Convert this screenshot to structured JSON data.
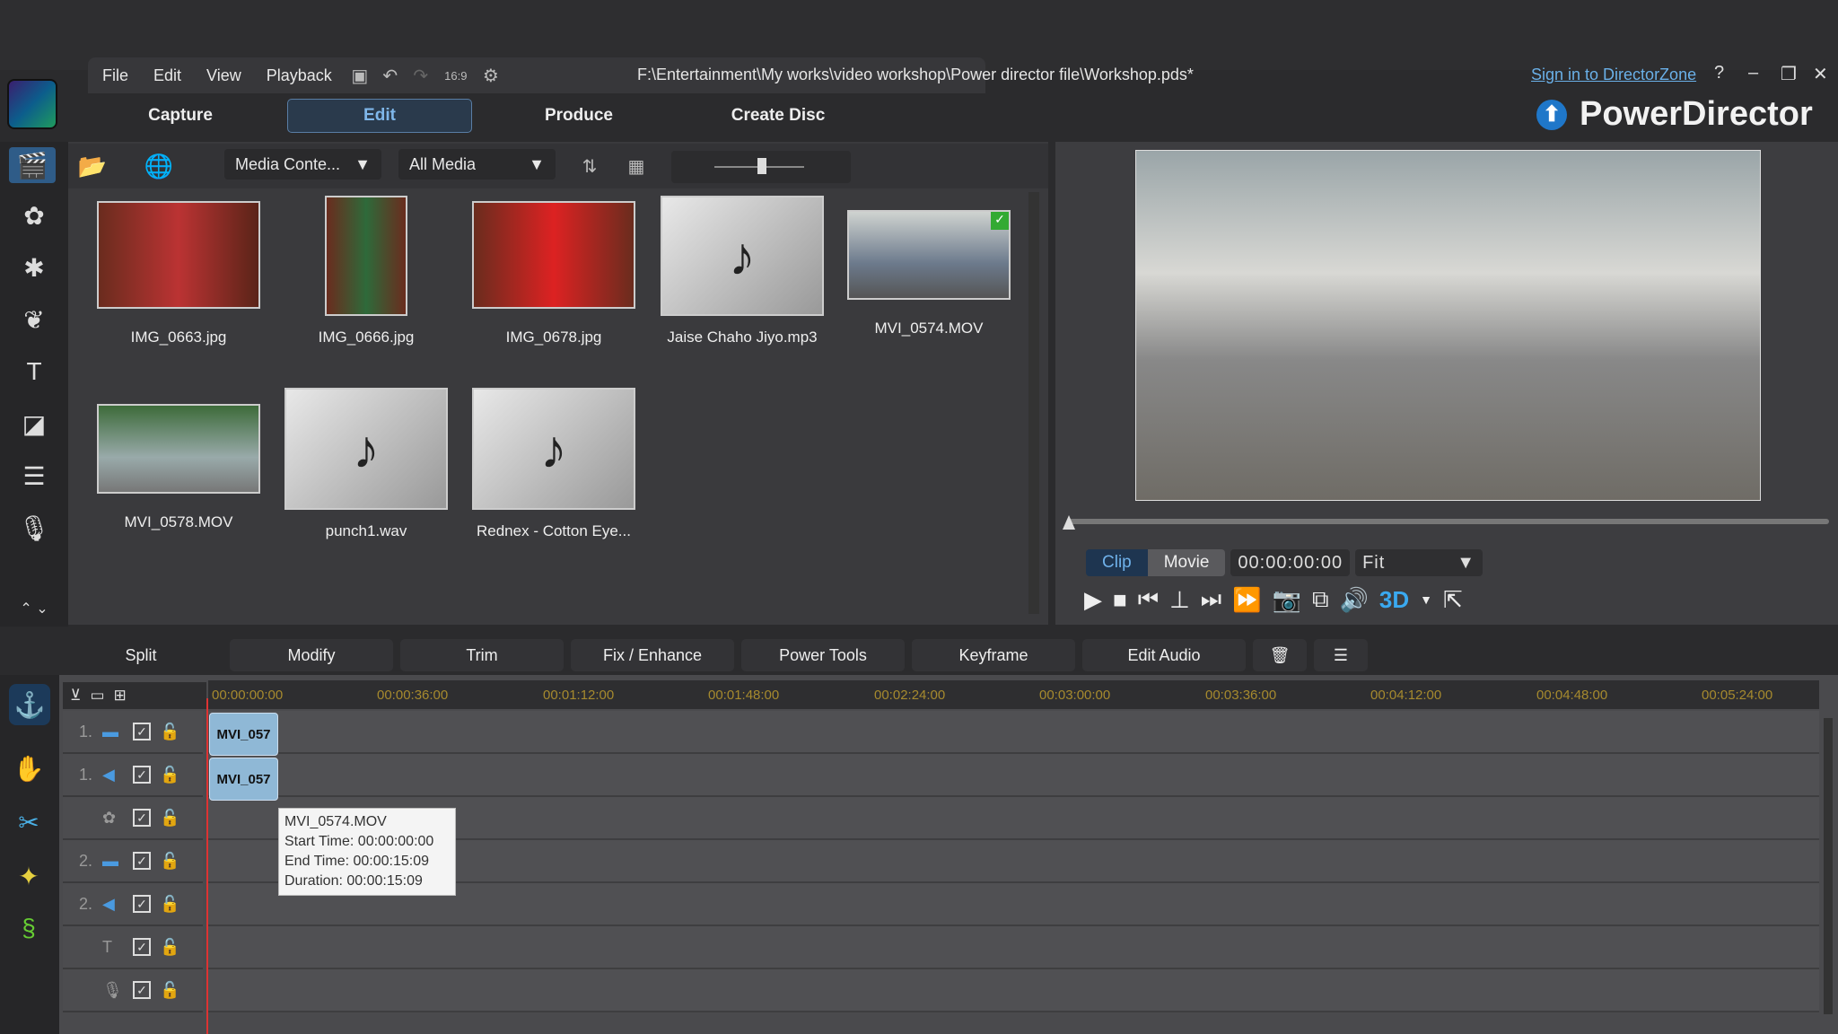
{
  "menu": [
    "File",
    "Edit",
    "View",
    "Playback"
  ],
  "aspect": "16:9",
  "file_path": "F:\\Entertainment\\My works\\video workshop\\Power director file\\Workshop.pds*",
  "sign_in": "Sign in to DirectorZone",
  "help": "?",
  "tabs": [
    "Capture",
    "Edit",
    "Produce",
    "Create Disc"
  ],
  "brand": "PowerDirector",
  "library": {
    "content_dropdown": "Media Conte...",
    "filter_dropdown": "All Media",
    "items": [
      {
        "name": "IMG_0663.jpg",
        "type": "photo"
      },
      {
        "name": "IMG_0666.jpg",
        "type": "photo"
      },
      {
        "name": "IMG_0678.jpg",
        "type": "photo"
      },
      {
        "name": "Jaise Chaho Jiyo.mp3",
        "type": "audio"
      },
      {
        "name": "MVI_0574.MOV",
        "type": "video"
      },
      {
        "name": "MVI_0578.MOV",
        "type": "video"
      },
      {
        "name": "punch1.wav",
        "type": "audio"
      },
      {
        "name": "Rednex - Cotton Eye...",
        "type": "audio"
      }
    ]
  },
  "preview": {
    "clip": "Clip",
    "movie": "Movie",
    "timecode": "00:00:00:00",
    "zoom": "Fit",
    "three_d": "3D"
  },
  "edit_toolbar": [
    "Split",
    "Modify",
    "Trim",
    "Fix / Enhance",
    "Power Tools",
    "Keyframe",
    "Edit Audio"
  ],
  "ruler": [
    "00:00:00:00",
    "00:00:36:00",
    "00:01:12:00",
    "00:01:48:00",
    "00:02:24:00",
    "00:03:00:00",
    "00:03:36:00",
    "00:04:12:00",
    "00:04:48:00",
    "00:05:24:00"
  ],
  "tracks": [
    {
      "num": "1.",
      "icon": "video"
    },
    {
      "num": "1.",
      "icon": "audio"
    },
    {
      "num": "",
      "icon": "fx"
    },
    {
      "num": "2.",
      "icon": "video"
    },
    {
      "num": "2.",
      "icon": "audio"
    },
    {
      "num": "",
      "icon": "title"
    },
    {
      "num": "",
      "icon": "voice"
    }
  ],
  "clips": {
    "video": "MVI_057",
    "audio": "MVI_057"
  },
  "tooltip": {
    "name": "MVI_0574.MOV",
    "start": "Start Time: 00:00:00:00",
    "end": "End Time: 00:00:15:09",
    "duration": "Duration: 00:00:15:09"
  }
}
